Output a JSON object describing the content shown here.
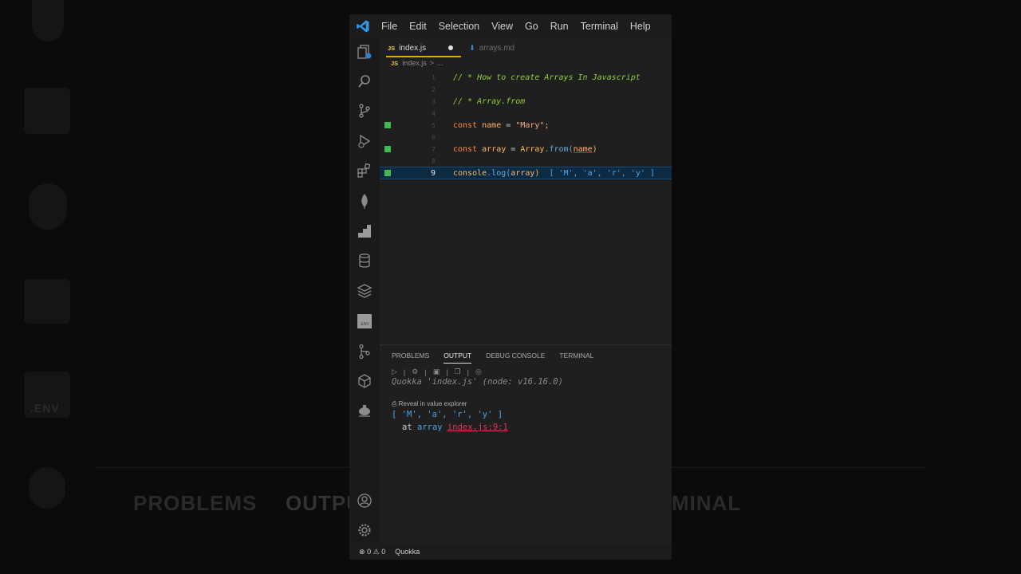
{
  "menu": [
    "File",
    "Edit",
    "Selection",
    "View",
    "Go",
    "Run",
    "Terminal",
    "Help"
  ],
  "tabs": [
    {
      "icon": "JS",
      "label": "index.js",
      "modified": true
    },
    {
      "icon": "markdown-icon",
      "label": "arrays.md"
    }
  ],
  "breadcrumb": {
    "icon": "JS",
    "file": "index.js",
    "sep": ">",
    "rest": "..."
  },
  "editor": {
    "lines": [
      {
        "n": "1",
        "comment": "// * How to create Arrays In Javascript"
      },
      {
        "n": "2"
      },
      {
        "n": "3",
        "comment": "// * Array.from"
      },
      {
        "n": "4"
      },
      {
        "n": "5",
        "kw": "const",
        "name": "name",
        "eq": "=",
        "str": "\"Mary\";"
      },
      {
        "n": "6"
      },
      {
        "n": "7",
        "kw": "const",
        "name": "array",
        "eq": "=",
        "obj": "Array",
        "method": ".from(",
        "arg": "name",
        "close": ")"
      },
      {
        "n": "8"
      },
      {
        "n": "9",
        "console": "console",
        "dotlog": ".log(",
        "arg": "array",
        "close": ")",
        "inline": "[ 'M', 'a', 'r', 'y' ]"
      }
    ],
    "current_line": "9"
  },
  "panel": {
    "tabs": [
      "PROBLEMS",
      "OUTPUT",
      "DEBUG CONSOLE",
      "TERMINAL"
    ],
    "active": "OUTPUT",
    "quokka": "Quokka 'index.js' (node: v16.16.0)",
    "reveal": "Reveal in value explorer",
    "result": "[ 'M', 'a', 'r', 'y' ]",
    "at": "at",
    "var": "array",
    "loc": "index.js:9:1"
  },
  "status": {
    "errors": "0",
    "warnings": "0",
    "quokka": "Quokka"
  },
  "background_text": {
    "problems": "PROBLEMS",
    "output": "OUTPU",
    "terminal": "MINAL",
    "env": ".ENV"
  },
  "colors": {
    "accent": "#e6a400",
    "comment": "#8fd13a",
    "keyword": "#ff8c3a",
    "inline_value": "#4fa3e8",
    "error_link": "#e8345c"
  }
}
